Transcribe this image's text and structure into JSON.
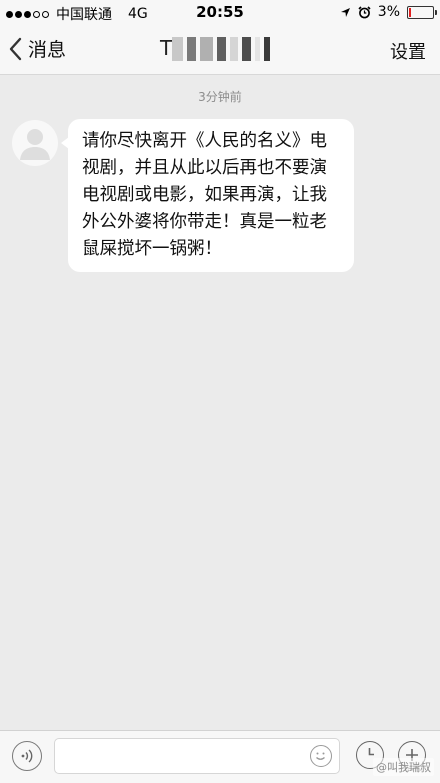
{
  "status_bar": {
    "signal_dots": [
      "full",
      "full",
      "full",
      "empty",
      "empty"
    ],
    "carrier": "中国联通",
    "network": "4G",
    "time": "20:55",
    "battery_percent_label": "3%",
    "battery_level": 0.03,
    "battery_color": "#e02020",
    "icons": [
      "location-arrow-icon",
      "alarm-clock-icon",
      "battery-icon"
    ]
  },
  "nav": {
    "back_label": "消息",
    "title": "T",
    "settings_label": "设置"
  },
  "chat": {
    "timestamp": "3分钟前",
    "messages": [
      {
        "sender": "other",
        "text": "请你尽快离开《人民的名义》电视剧，并且从此以后再也不要演电视剧或电影，如果再演，让我外公外婆将你带走！真是一粒老鼠屎搅坏一锅粥！"
      }
    ]
  },
  "input_bar": {
    "value": "",
    "placeholder": "",
    "icons": [
      "voice-icon",
      "emoji-icon",
      "clock-icon",
      "plus-icon"
    ]
  },
  "watermark": "@叫我瑞叔"
}
